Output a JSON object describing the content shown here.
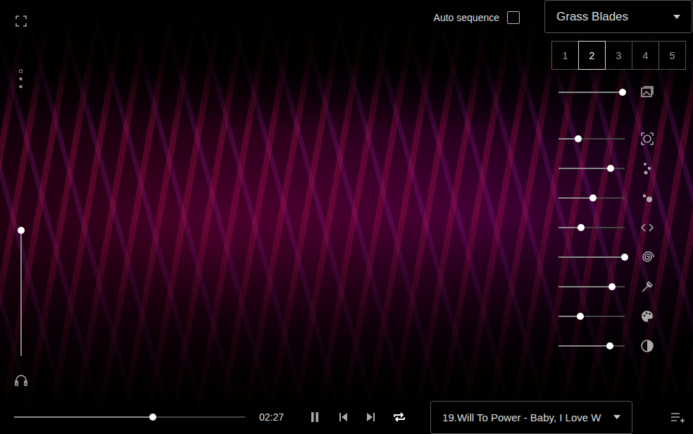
{
  "auto_sequence": {
    "label": "Auto sequence",
    "checked": false
  },
  "preset_dropdown": {
    "value": "Grass Blades"
  },
  "preset_tabs": [
    {
      "label": "1",
      "selected": false
    },
    {
      "label": "2",
      "selected": true
    },
    {
      "label": "3",
      "selected": false
    },
    {
      "label": "4",
      "selected": false
    },
    {
      "label": "5",
      "selected": false
    }
  ],
  "effect_sliders": [
    {
      "level": 0.97
    },
    {
      "level": 0.3
    },
    {
      "level": 0.79
    },
    {
      "level": 0.52
    },
    {
      "level": 0.34
    },
    {
      "level": 1.0
    },
    {
      "level": 0.81
    },
    {
      "level": 0.33
    },
    {
      "level": 0.78
    }
  ],
  "volume": {
    "level": 1.0
  },
  "player": {
    "level": 0.6,
    "time": "02:27",
    "playing": true,
    "repeat": true,
    "track": "19.Will To Power - Baby, I Love W"
  }
}
